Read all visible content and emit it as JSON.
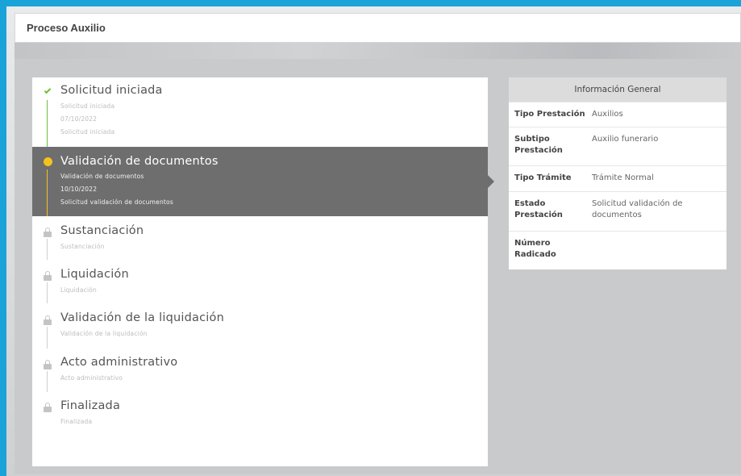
{
  "header": {
    "title": "Proceso Auxilio"
  },
  "steps": [
    {
      "title": "Solicitud iniciada",
      "status": "completed",
      "details": [
        "Solicitud iniciada",
        "07/10/2022",
        "Solicitud iniciada"
      ]
    },
    {
      "title": "Validación de documentos",
      "status": "current",
      "details": [
        "Validación de documentos",
        "10/10/2022",
        "Solicitud validación de documentos"
      ]
    },
    {
      "title": "Sustanciación",
      "status": "locked",
      "details": [
        "Sustanciación"
      ]
    },
    {
      "title": "Liquidación",
      "status": "locked",
      "details": [
        "Liquidación"
      ]
    },
    {
      "title": "Validación de la liquidación",
      "status": "locked",
      "details": [
        "Validación de la liquidación"
      ]
    },
    {
      "title": "Acto administrativo",
      "status": "locked",
      "details": [
        "Acto administrativo"
      ]
    },
    {
      "title": "Finalizada",
      "status": "locked",
      "details": [
        "Finalizada"
      ]
    }
  ],
  "info": {
    "title": "Información General",
    "rows": [
      {
        "label": "Tipo Prestación",
        "value": "Auxilios"
      },
      {
        "label": "Subtipo Prestación",
        "value": "Auxilio funerario"
      },
      {
        "label": "Tipo Trámite",
        "value": "Trámite Normal"
      },
      {
        "label": "Estado Prestación",
        "value": "Solicitud validación de documentos"
      },
      {
        "label": "Número Radicado",
        "value": ""
      }
    ]
  },
  "colors": {
    "completed": "#6cbf3a",
    "current": "#f4c21b",
    "locked": "#c4c4c4",
    "active_bg": "#6e6e6e",
    "frame": "#1aa3d9"
  },
  "icons": {
    "completed": "check-icon",
    "current": "dot-icon",
    "locked": "lock-icon"
  }
}
